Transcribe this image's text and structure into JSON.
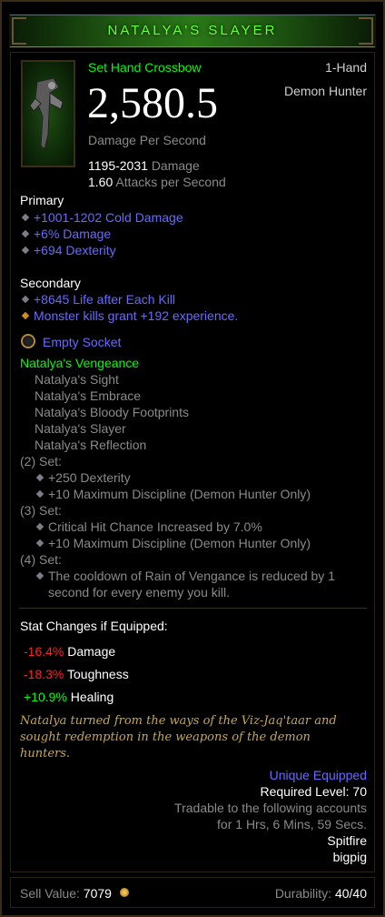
{
  "title": "NATALYA'S SLAYER",
  "item": {
    "type": "Set Hand Crossbow",
    "handed": "1-Hand",
    "class": "Demon Hunter",
    "dps": "2,580.5",
    "dps_label": "Damage Per Second",
    "damage_range": "1195-2031",
    "damage_word": "Damage",
    "aps_value": "1.60",
    "aps_word": "Attacks per Second"
  },
  "primary": {
    "heading": "Primary",
    "stats": [
      "+1001-1202 Cold Damage",
      "+6% Damage",
      "+694 Dexterity"
    ]
  },
  "secondary": {
    "heading": "Secondary",
    "stats": [
      "+8645 Life after Each Kill",
      "Monster kills grant +192 experience."
    ]
  },
  "socket": "Empty Socket",
  "set": {
    "name": "Natalya's Vengeance",
    "pieces": [
      "Natalya's Sight",
      "Natalya's Embrace",
      "Natalya's Bloody Footprints",
      "Natalya's Slayer",
      "Natalya's Reflection"
    ],
    "bonus2_label": "(2) Set:",
    "bonus2": [
      "+250 Dexterity",
      "+10 Maximum Discipline (Demon Hunter Only)"
    ],
    "bonus3_label": "(3) Set:",
    "bonus3": [
      "Critical Hit Chance Increased by 7.0%",
      "+10 Maximum Discipline (Demon Hunter Only)"
    ],
    "bonus4_label": "(4) Set:",
    "bonus4_line1": "The cooldown of Rain of Vengance is reduced by 1",
    "bonus4_line2": "second for every enemy you kill."
  },
  "stat_changes": {
    "heading": "Stat Changes if Equipped:",
    "rows": [
      {
        "value": "-16.4%",
        "label": "Damage",
        "color": "#ff2222"
      },
      {
        "value": "-18.3%",
        "label": "Toughness",
        "color": "#ff2222"
      },
      {
        "value": "+10.9%",
        "label": "Healing",
        "color": "#00ff00"
      }
    ]
  },
  "flavor": {
    "line1": "Natalya turned from the ways of the Viz-Jaq'taar and",
    "line2": "sought redemption in the weapons of the demon",
    "line3": "hunters."
  },
  "meta": {
    "unique": "Unique Equipped",
    "required_level": "Required Level: 70",
    "trade_line1": "Tradable to the following accounts",
    "trade_line2": "for 1 Hrs, 6 Mins, 59 Secs.",
    "accounts": [
      "Spitfire",
      "bigpig"
    ]
  },
  "footer": {
    "sell_label": "Sell Value:",
    "sell_value": "7079",
    "durability_label": "Durability:",
    "durability_value": "40/40"
  },
  "colors": {
    "set_green": "#00ff00",
    "magic_blue": "#6969ff",
    "flavor_gold": "#c7a74f",
    "negative_red": "#ff2222"
  },
  "icons": [
    "hand-crossbow-icon",
    "socket-icon",
    "gold-coin-icon"
  ]
}
